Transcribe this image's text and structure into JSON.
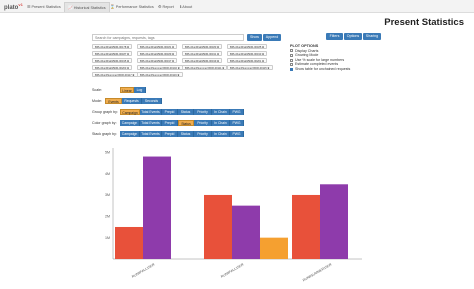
{
  "app": {
    "brand": "plato",
    "brand_sup": "v1"
  },
  "nav": {
    "tabs": [
      {
        "label": "☰ Present Statistics",
        "active": false
      },
      {
        "label": "📈 Historical Statistics",
        "active": true
      },
      {
        "label": "⌛ Performance Statistics",
        "active": false
      },
      {
        "label": "⚙ Report",
        "active": false
      },
      {
        "label": "ℹ About",
        "active": false
      }
    ]
  },
  "header": {
    "title": "Present Statistics"
  },
  "search": {
    "placeholder": "Search for campaigns, requests, tags",
    "show_label": "Show",
    "append_label": "Append"
  },
  "right_buttons": {
    "filters": "Filters",
    "options": "Options",
    "sharing": "Sharing"
  },
  "campaign_tags": [
    "BPH-RunIIFall15DR-00178 ✖",
    "BPH-RunIIFall15DR-00181 ✖",
    "BPH-RunIIFall15DR-00183 ✖",
    "BPH-RunIIFall15DR-00185 ✖",
    "BPH-RunIIFall15DR-00187 ✖",
    "BPH-RunIIFall15DR-00189 ✖",
    "BPH-RunIIFall15DR-00191 ✖",
    "BPH-RunIIFall15DR-00193 ✖",
    "BPH-RunIIFall15DR-00195 ✖",
    "BPH-RunIIFall15DR-00197 ✖",
    "BPH-RunIIFall15DR-00199 ✖",
    "BPH-RunIIFall15DR-00201 ✖",
    "BPH-RunIIFall15DR-00203 ✖",
    "BPH-RunIISummer15DR-00102 ✖",
    "BPH-RunIISummer15DR-00111 ✖",
    "BPH-RunIISummer15DR-00115 ✖",
    "BPH-RunIISummer15DR-00117 ✖",
    "BPH-RunIISummer15DR-00119 ✖"
  ],
  "plot_options": {
    "header": "PLOT OPTIONS",
    "items": [
      {
        "label": "Display Charts",
        "checked": false
      },
      {
        "label": "Growing Mode",
        "checked": false
      },
      {
        "label": "Use % scale for large numbers",
        "checked": false
      },
      {
        "label": "Estimate completed events",
        "checked": false
      },
      {
        "label": "Show table for unchained requests",
        "checked": true
      }
    ]
  },
  "controls": {
    "scale": {
      "label": "Scale:",
      "options": [
        "Linear",
        "Log"
      ],
      "active": 0
    },
    "mode": {
      "label": "Mode:",
      "options": [
        "Events",
        "Requests",
        "Seconds"
      ],
      "active": 0
    },
    "group": {
      "label": "Group graph by:",
      "options": [
        "Campaign",
        "Total Events",
        "Prepid",
        "Status",
        "Priority",
        "In Chain",
        "PWG"
      ],
      "active": 0
    },
    "color": {
      "label": "Color graph by:",
      "options": [
        "Campaign",
        "Total Events",
        "Prepid",
        "Status",
        "Priority",
        "In Chain",
        "PWG"
      ],
      "active": 3
    },
    "stack": {
      "label": "Stack graph by:",
      "options": [
        "Campaign",
        "Total Events",
        "Prepid",
        "Status",
        "Priority",
        "In Chain",
        "PWG"
      ],
      "active": -1
    }
  },
  "chart_data": {
    "type": "bar",
    "categories": [
      "RunIIFall15DR",
      "RunIIFall15DR",
      "RunIISummer15DR"
    ],
    "category_labels": [
      "RUNIIFALL15DR",
      "RUNIIFALL15DR",
      "RUNIISUMMER15DR"
    ],
    "series": [
      {
        "color": "#e8513a",
        "values": [
          1.5,
          3.0,
          3.0
        ]
      },
      {
        "color": "#8e3bab",
        "values": [
          4.8,
          2.5,
          3.5
        ]
      },
      {
        "color": "#f5a030",
        "values": [
          null,
          1.0,
          null
        ]
      }
    ],
    "yticks": [
      "1M",
      "2M",
      "3M",
      "4M",
      "5M"
    ],
    "ylim": [
      0,
      5.2
    ]
  }
}
